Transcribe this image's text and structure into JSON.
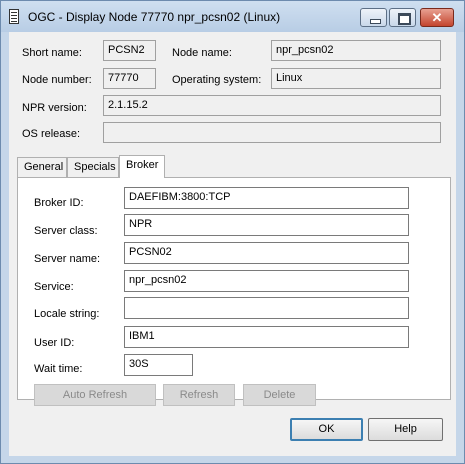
{
  "window": {
    "title": "OGC - Display Node 77770  npr_pcsn02 (Linux)"
  },
  "node": {
    "short_name_label": "Short name:",
    "short_name": "PCSN2",
    "node_name_label": "Node name:",
    "node_name": "npr_pcsn02",
    "node_number_label": "Node number:",
    "node_number": "77770",
    "os_label": "Operating system:",
    "os": "Linux",
    "npr_version_label": "NPR version:",
    "npr_version": "2.1.15.2",
    "os_release_label": "OS release:",
    "os_release": ""
  },
  "tabs": [
    {
      "label": "General"
    },
    {
      "label": "Specials"
    },
    {
      "label": "Broker"
    }
  ],
  "broker": {
    "broker_id_label": "Broker ID:",
    "broker_id": "DAEFIBM:3800:TCP",
    "server_class_label": "Server class:",
    "server_class": "NPR",
    "server_name_label": "Server name:",
    "server_name": "PCSN02",
    "service_label": "Service:",
    "service": "npr_pcsn02",
    "locale_label": "Locale string:",
    "locale": "",
    "user_id_label": "User ID:",
    "user_id": "IBM1",
    "wait_time_label": "Wait time:",
    "wait_time": "30S",
    "auto_refresh": "Auto Refresh",
    "refresh": "Refresh",
    "delete": "Delete"
  },
  "buttons": {
    "ok": "OK",
    "help": "Help"
  }
}
